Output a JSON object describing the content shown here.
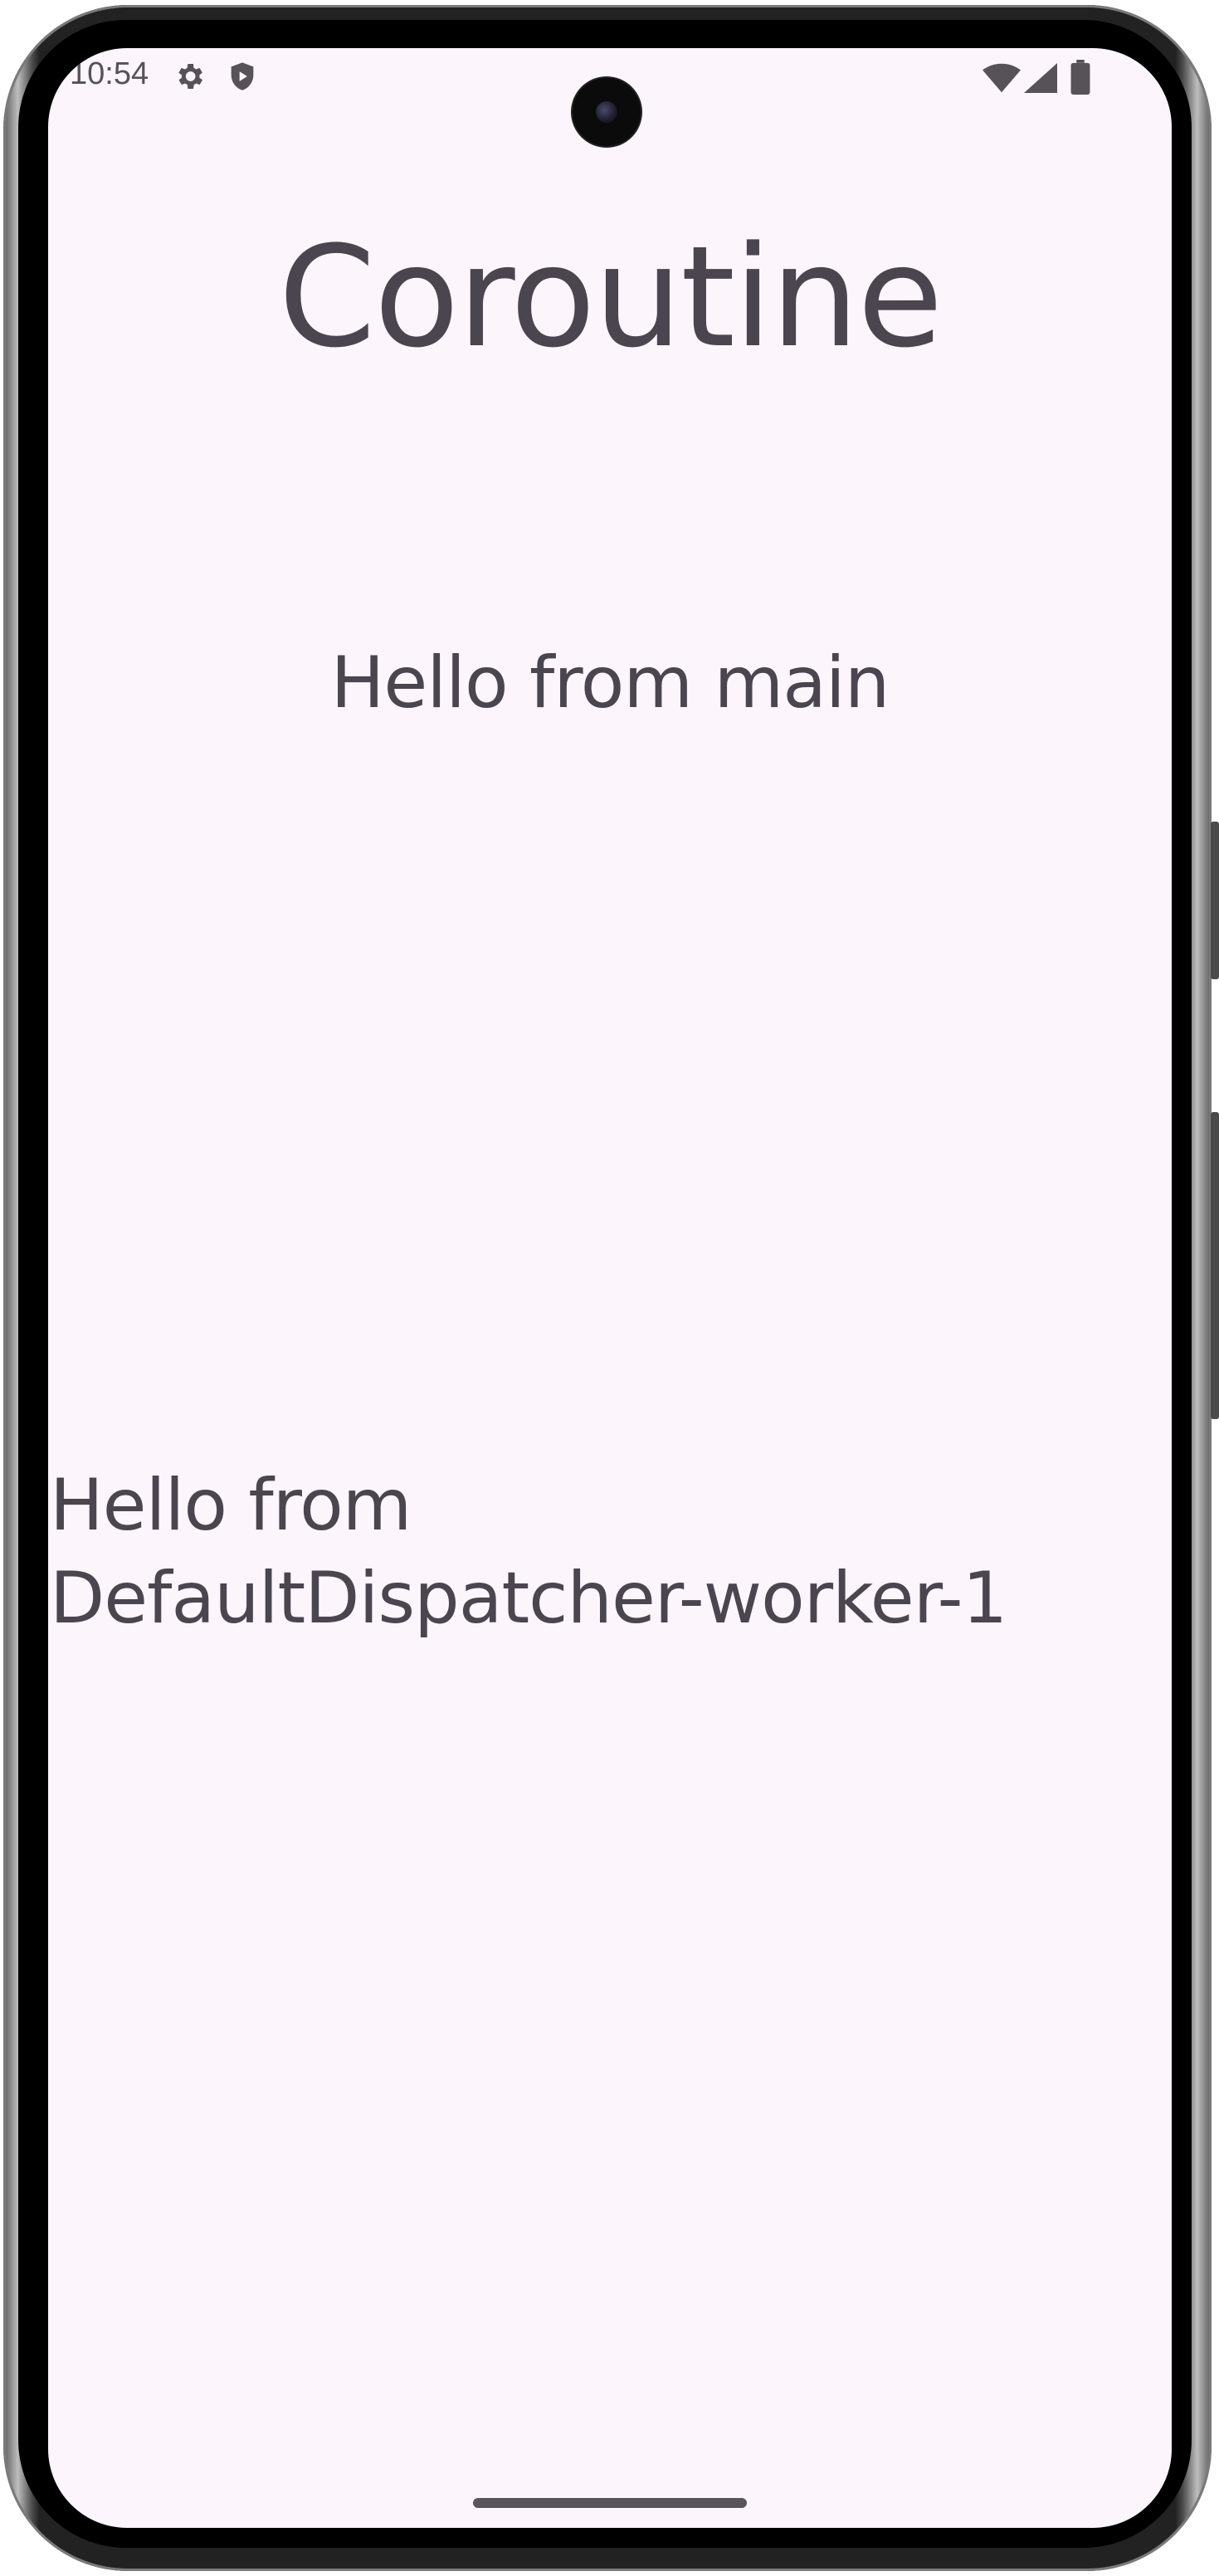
{
  "status_bar": {
    "time": "10:54",
    "icons": [
      "gear-icon",
      "shield-play-icon",
      "wifi-icon",
      "cell-signal-icon",
      "battery-icon"
    ]
  },
  "app": {
    "title": "Coroutine",
    "main_message": "Hello from main",
    "worker_message": "Hello from\nDefaultDispatcher-worker-1"
  },
  "colors": {
    "background": "#fcf5fc",
    "text": "#4a454f"
  }
}
